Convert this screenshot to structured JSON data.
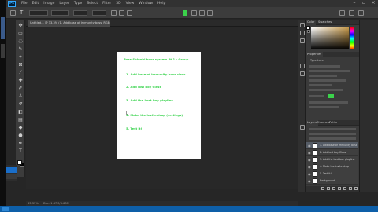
{
  "app": {
    "logo_text": "Ps",
    "menu": [
      "File",
      "Edit",
      "Image",
      "Layer",
      "Type",
      "Select",
      "Filter",
      "3D",
      "View",
      "Window",
      "Help"
    ]
  },
  "document": {
    "tab_title": "Untitled-1 @ 33.3% (1. Add base of Immunity boss, RGB/8) *"
  },
  "paper": {
    "title": "Boss Shinobi boss system Pt 1 - Group",
    "items": [
      "1. Add base of immunity boss class",
      "2. Add lost boy Class",
      "3. Add the Lost boy playline",
      "4. Make the invite drop (settings)",
      "5. Test it!"
    ]
  },
  "panels": {
    "color_tabs": [
      "Color",
      "Swatches"
    ],
    "properties_tab": "Properties",
    "properties_sub": "Type Layer",
    "layers_tabs": [
      "Layers",
      "Channels",
      "Paths"
    ],
    "layers": [
      "1. Add base of immunity boss class",
      "2. Add lost boy Class",
      "3. Add the Lost boy playline",
      "4. Make the invite drop",
      "5. Test it!",
      "Background"
    ]
  },
  "status": {
    "zoom": "33.33%",
    "doc_info": "Doc: 1.37M/3.63M"
  },
  "colors": {
    "accent_green": "#35d24a",
    "taskbar_blue": "#0e5fa8",
    "selected_layer": "#555c66"
  }
}
